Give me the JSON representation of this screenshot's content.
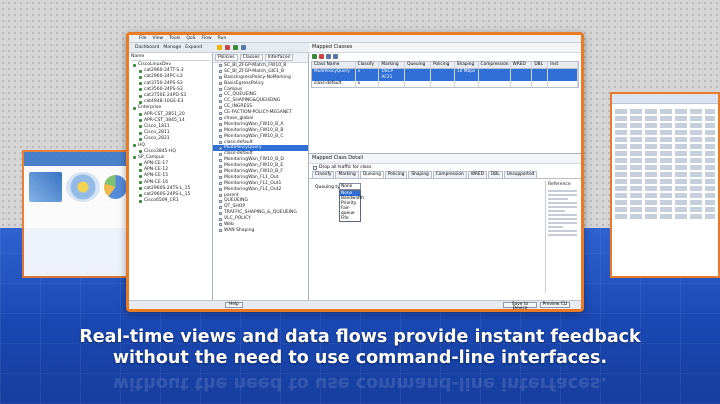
{
  "caption": {
    "line1": "Real-time views and data flows provide instant feedback",
    "line2": "without the need to use command-line interfaces."
  },
  "menu": [
    "File",
    "View",
    "Tools",
    "QoS",
    "Flow",
    "Run"
  ],
  "left_toolbar": [
    "Dashboard",
    "Manage",
    "Expand"
  ],
  "tree": {
    "header": "Name",
    "items": [
      {
        "label": "CiscoLinuxDev",
        "level": 0,
        "color": "#3a8a3a"
      },
      {
        "label": "cat2960-24TT-S.3",
        "level": 1,
        "color": "#3a8a3a"
      },
      {
        "label": "cat2960-24PC-L3",
        "level": 1,
        "color": "#3a8a3a"
      },
      {
        "label": "cat3750-24PS-S3",
        "level": 1,
        "color": "#3a8a3a"
      },
      {
        "label": "cat3560-24PS-S3",
        "level": 1,
        "color": "#3a8a3a"
      },
      {
        "label": "cat3750E-24PD-S3",
        "level": 1,
        "color": "#3a8a3a"
      },
      {
        "label": "cat4948-10GE-E3",
        "level": 1,
        "color": "#3a8a3a"
      },
      {
        "label": "Enterprise",
        "level": 0,
        "color": "#3a8a3a"
      },
      {
        "label": "APR-CST_2851_20",
        "level": 1,
        "color": "#3a8a3a"
      },
      {
        "label": "APR-CST_3845_14",
        "level": 1,
        "color": "#3a8a3a"
      },
      {
        "label": "Cisco_1811",
        "level": 1,
        "color": "#3a8a3a"
      },
      {
        "label": "Cisco_2811",
        "level": 1,
        "color": "#3a8a3a"
      },
      {
        "label": "Cisco_2821",
        "level": 1,
        "color": "#3a8a3a"
      },
      {
        "label": "HQ",
        "level": 0,
        "color": "#3a8a3a"
      },
      {
        "label": "Cisco3845-HQ",
        "level": 1,
        "color": "#3a8a3a"
      },
      {
        "label": "SP_Campus",
        "level": 0,
        "color": "#3a8a3a"
      },
      {
        "label": "APN-CE-17",
        "level": 1,
        "color": "#3a8a3a"
      },
      {
        "label": "APN-CE-12",
        "level": 1,
        "color": "#3a8a3a"
      },
      {
        "label": "APN-CE-15",
        "level": 1,
        "color": "#3a8a3a"
      },
      {
        "label": "APN-CE-16",
        "level": 1,
        "color": "#3a8a3a"
      },
      {
        "label": "cat2960S-24TS-L_15",
        "level": 1,
        "color": "#3a8a3a"
      },
      {
        "label": "cat2960S-24PS-L_15",
        "level": 1,
        "color": "#3a8a3a"
      },
      {
        "label": "Cisco6509_CR1",
        "level": 1,
        "color": "#3a8a3a"
      }
    ]
  },
  "policy_toolbar": [
    "Policies",
    "Classes",
    "Interfaces"
  ],
  "policy_tree": {
    "items": [
      {
        "label": "SC_BI_ZFGP-Match_FW10_B",
        "selected": false
      },
      {
        "label": "SC_BI_ZFGP-Match_GIE1_B",
        "selected": false
      },
      {
        "label": "BasicIngressPolicy-NoMarking",
        "selected": false
      },
      {
        "label": "BasicEgressPolicy",
        "selected": false
      },
      {
        "label": "Campus",
        "selected": false
      },
      {
        "label": "CC_QUEUEING",
        "selected": false
      },
      {
        "label": "CC_SHAPING&QUEUEING",
        "selected": false
      },
      {
        "label": "CE_INGRESS",
        "selected": false
      },
      {
        "label": "CE-FACTION-POLICY-MEGANET",
        "selected": false
      },
      {
        "label": "chase_global",
        "selected": false
      },
      {
        "label": "MonitoringWan_FW10_B_A",
        "selected": false
      },
      {
        "label": "MonitoringWan_FW10_B_B",
        "selected": false
      },
      {
        "label": "MonitoringWan_FW10_B_C",
        "selected": false
      },
      {
        "label": "class-default",
        "selected": false
      },
      {
        "label": "MultiPolicyQuery",
        "selected": true
      },
      {
        "label": "class-default",
        "selected": false
      },
      {
        "label": "MonitoringWan_FW10_B_D",
        "selected": false
      },
      {
        "label": "MonitoringWan_FW10_B_E",
        "selected": false
      },
      {
        "label": "MonitoringWan_FW10_B_F",
        "selected": false
      },
      {
        "label": "MonitoringWan_FL1_Out",
        "selected": false
      },
      {
        "label": "MonitoringWan_FL1_Out1",
        "selected": false
      },
      {
        "label": "MonitoringWan_FL1_Out2",
        "selected": false
      },
      {
        "label": "parent",
        "selected": false
      },
      {
        "label": "QUEUEING",
        "selected": false
      },
      {
        "label": "QT_SHOP",
        "selected": false
      },
      {
        "label": "TRAFFIC_SHAPING_&_QUEUEING",
        "selected": false
      },
      {
        "label": "VLC_POLICY",
        "selected": false
      },
      {
        "label": "Web",
        "selected": false
      },
      {
        "label": "WAN Shaping",
        "selected": false
      }
    ]
  },
  "class_map_pane": {
    "title": "Mapped Classes",
    "headers": [
      "Class Name",
      "Classify",
      "Marking",
      "Queuing",
      "Policing",
      "Shaping",
      "Compression",
      "WRED",
      "DBL",
      "Inst"
    ],
    "rows": [
      {
        "cells": [
          "MultiPolicyQuery",
          "x",
          "DSCP AF21",
          "",
          "",
          "10 Mbps",
          "",
          "",
          "",
          ""
        ],
        "selected": true
      },
      {
        "cells": [
          "class-default",
          "x",
          "",
          "",
          "",
          "",
          "",
          "",
          "",
          ""
        ],
        "selected": false
      }
    ]
  },
  "detail_pane": {
    "title": "Mapped Class Detail",
    "checkbox_label": "Drop all traffic for class",
    "tabs": [
      "Classify",
      "Marking",
      "Queuing",
      "Policing",
      "Shaping",
      "Compression",
      "WRED",
      "DBL",
      "Unsupported"
    ],
    "active_tab": "Queuing",
    "queuing_type_label": "Queuing type:",
    "queuing_type_value": "None",
    "dropdown_options": [
      "None",
      "Bandwidth",
      "Priority",
      "Fair-queue",
      "Fifo"
    ],
    "reference_title": "Reference"
  },
  "status_bar": {
    "help_label": "Help",
    "save_label": "Save to Device",
    "preview_label": "Preview CLI"
  },
  "colors": {
    "frame_accent": "#ea7a23",
    "selection": "#2f6fd6",
    "background_blue": "#1c4fb7"
  }
}
